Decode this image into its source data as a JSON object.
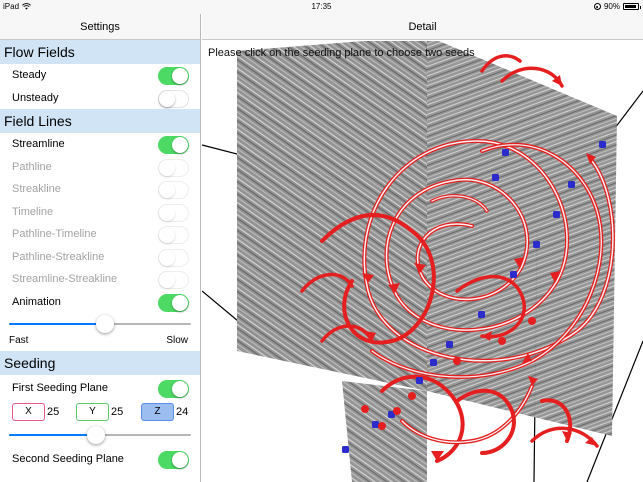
{
  "status": {
    "device": "iPad",
    "time": "17:35",
    "battery": "90%",
    "battery_level": 0.9
  },
  "sidebar": {
    "title": "Settings",
    "flow_fields": {
      "header": "Flow Fields",
      "items": [
        {
          "label": "Steady",
          "on": true,
          "enabled": true
        },
        {
          "label": "Unsteady",
          "on": false,
          "enabled": true
        }
      ]
    },
    "field_lines": {
      "header": "Field Lines",
      "items": [
        {
          "label": "Streamline",
          "on": true,
          "enabled": true
        },
        {
          "label": "Pathline",
          "on": false,
          "enabled": false
        },
        {
          "label": "Streakline",
          "on": false,
          "enabled": false
        },
        {
          "label": "Timeline",
          "on": false,
          "enabled": false
        },
        {
          "label": "Pathline-Timeline",
          "on": false,
          "enabled": false
        },
        {
          "label": "Pathline-Streakline",
          "on": false,
          "enabled": false
        },
        {
          "label": "Streamline-Streakline",
          "on": false,
          "enabled": false
        },
        {
          "label": "Animation",
          "on": true,
          "enabled": true
        }
      ],
      "speed_slider": {
        "value": 0.53,
        "min_label": "Fast",
        "max_label": "Slow"
      }
    },
    "seeding": {
      "header": "Seeding",
      "first_plane": {
        "label": "First Seeding Plane",
        "on": true
      },
      "axes": [
        {
          "label": "X",
          "value": "25",
          "color": "#e35a86",
          "selected": false
        },
        {
          "label": "Y",
          "value": "25",
          "color": "#5ccb6a",
          "selected": false
        },
        {
          "label": "Z",
          "value": "24",
          "color": "#5b8ee6",
          "selected": true
        }
      ],
      "plane_slider": {
        "value": 0.48
      },
      "second_plane": {
        "label": "Second Seeding Plane",
        "on": true
      }
    }
  },
  "detail": {
    "title": "Detail",
    "hint": "Please click on the seeding plane to choose two seeds"
  },
  "colors": {
    "accent": "#007aff",
    "toggle_on": "#4cd964",
    "section_bg": "#d0e4f6",
    "streamline": "#e51f1f",
    "seed": "#2c2ccc"
  }
}
